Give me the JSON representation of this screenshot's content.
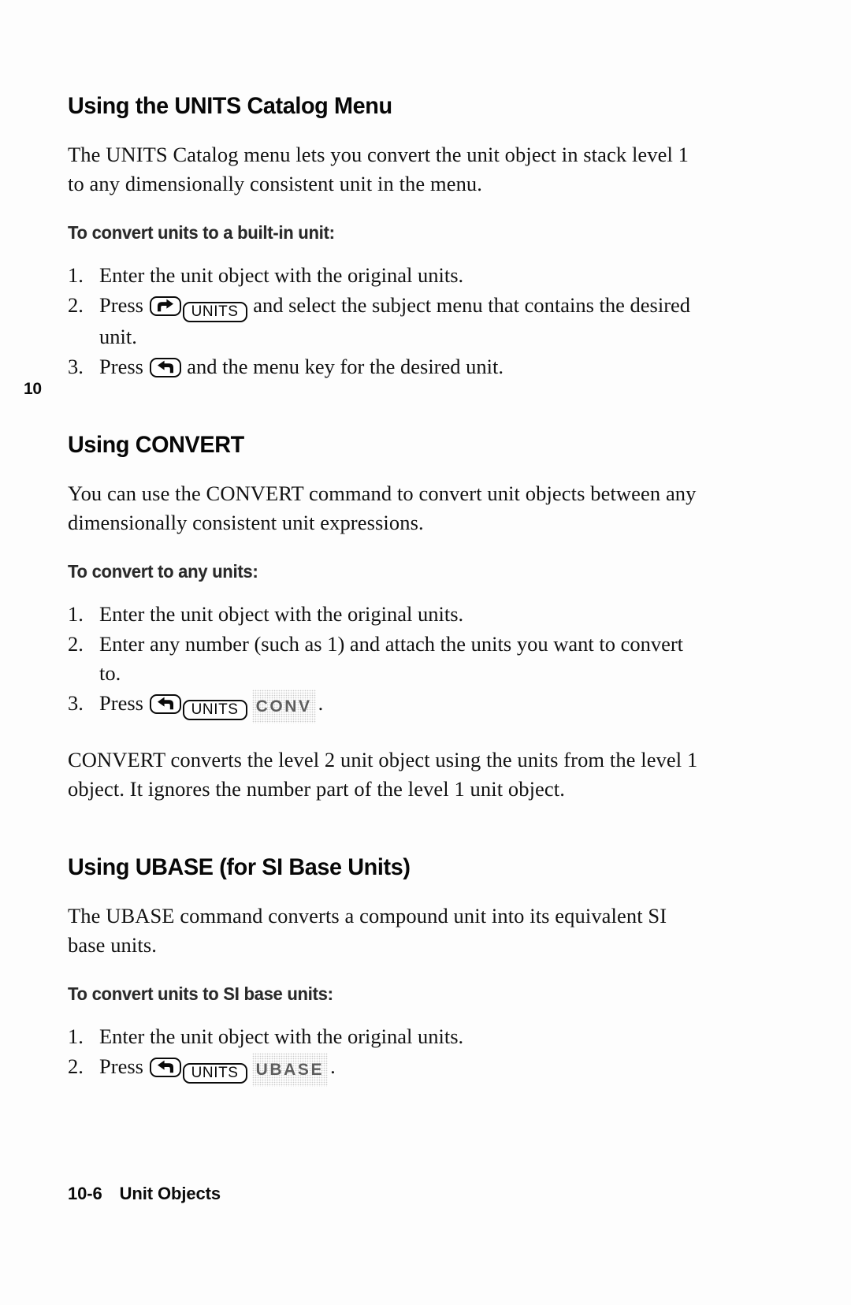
{
  "page": {
    "chapter_tab": "10",
    "footer_page_number": "10-6",
    "footer_title": "Unit Objects"
  },
  "sections": [
    {
      "heading": "Using the UNITS Catalog Menu",
      "intro": "The UNITS Catalog menu lets you convert the unit object in stack level 1 to any dimensionally consistent unit in the menu.",
      "subheading": "To convert units to a built-in unit:",
      "steps": [
        {
          "pre": "Enter the unit object with the original units."
        },
        {
          "pre": "Press ",
          "keys": [
            "right-shift-arrow-key",
            "UNITS"
          ],
          "post": " and select the subject menu that contains the desired unit."
        },
        {
          "pre": "Press ",
          "keys": [
            "left-shift-arrow-key"
          ],
          "post": " and the menu key for the desired unit."
        }
      ]
    },
    {
      "heading": "Using CONVERT",
      "intro": "You can use the CONVERT command to convert unit objects between any dimensionally consistent unit expressions.",
      "subheading": "To convert to any units:",
      "steps": [
        {
          "pre": "Enter the unit object with the original units."
        },
        {
          "pre": "Enter any number (such as 1) and attach the units you want to convert to."
        },
        {
          "pre": "Press ",
          "keys": [
            "left-shift-arrow-key",
            "UNITS"
          ],
          "menu": "CONV",
          "post": "."
        }
      ],
      "outro": "CONVERT converts the level 2 unit object using the units from the level 1 object. It ignores the number part of the level 1 unit object."
    },
    {
      "heading": "Using UBASE (for SI Base Units)",
      "intro": "The UBASE command converts a compound unit into its equivalent SI base units.",
      "subheading": "To convert units to SI base units:",
      "steps": [
        {
          "pre": "Enter the unit object with the original units."
        },
        {
          "pre": "Press ",
          "keys": [
            "left-shift-arrow-key",
            "UNITS"
          ],
          "menu": "UBASE",
          "post": "."
        }
      ]
    }
  ],
  "keys": {
    "units_label": "UNITS",
    "right_arrow_icon": "right-shift-arrow-icon",
    "left_arrow_icon": "left-shift-arrow-icon"
  },
  "colors": {
    "ink": "#0b0b0b",
    "paper": "#fdfdfd",
    "lcd_label": "#5d5d5d"
  }
}
